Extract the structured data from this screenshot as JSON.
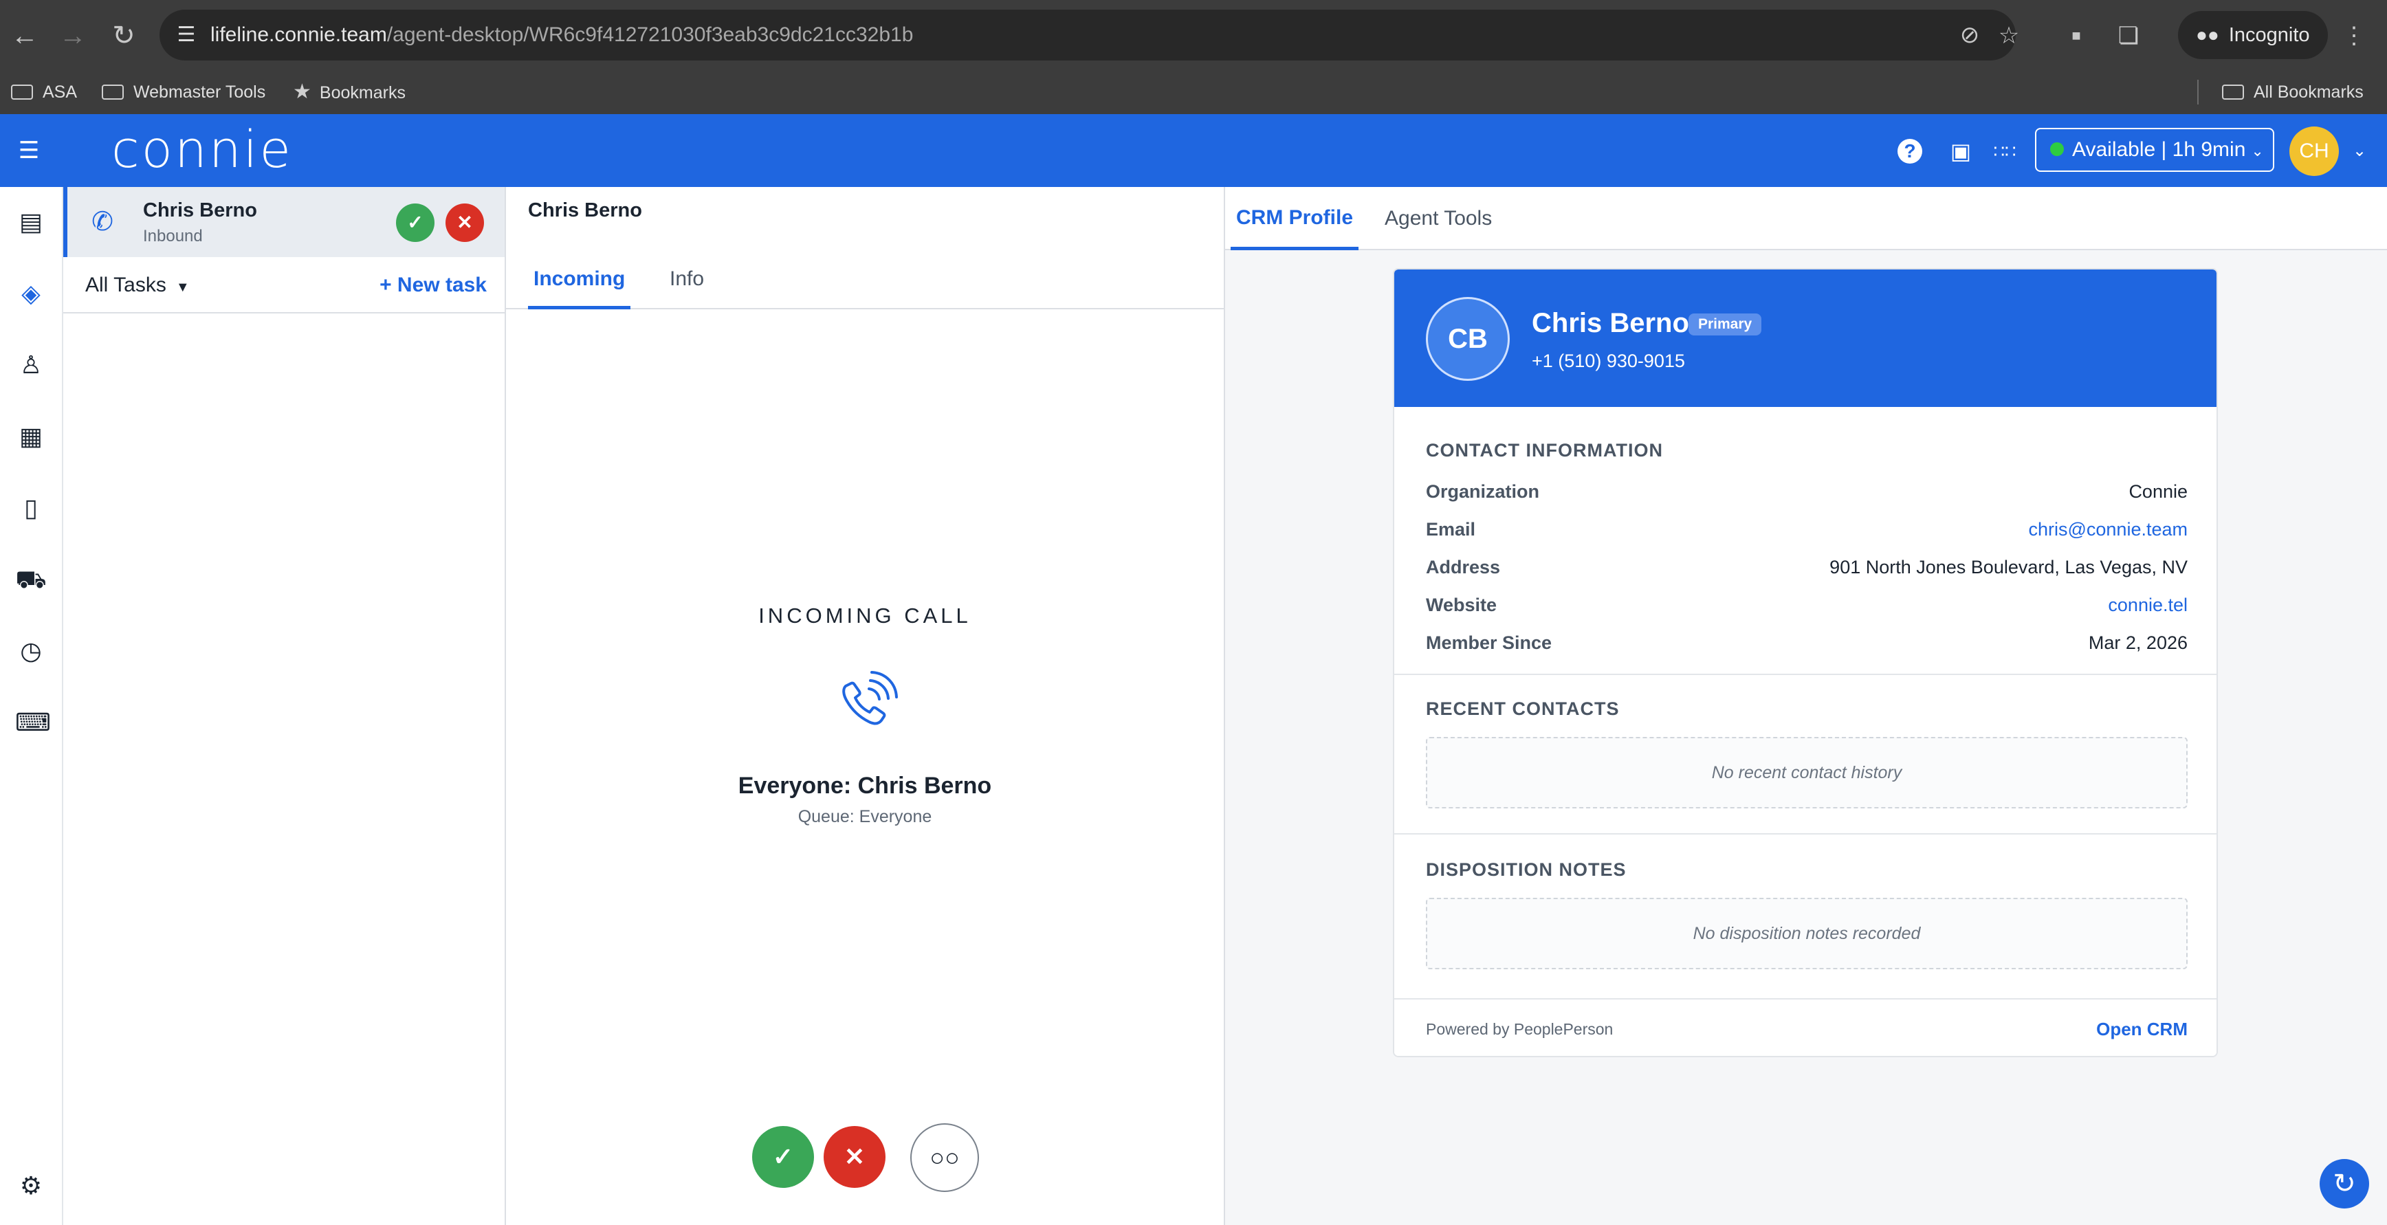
{
  "browser": {
    "url_host": "lifeline.connie.team",
    "url_path": "/agent-desktop/WR6c9f412721030f3eab3c9dc21cc32b1b",
    "incognito_label": "Incognito",
    "bookmarks": [
      {
        "label": "ASA",
        "icon": "folder-icon"
      },
      {
        "label": "Webmaster Tools",
        "icon": "folder-icon"
      },
      {
        "label": "Bookmarks",
        "icon": "star-icon"
      }
    ],
    "all_bookmarks_label": "All Bookmarks"
  },
  "header": {
    "logo_text": "connie",
    "status_label": "Available | 1h 9min",
    "status_color": "#2ecc40",
    "avatar_initials": "CH",
    "brand_color": "#1f66e0"
  },
  "task": {
    "name": "Chris Berno",
    "direction": "Inbound",
    "filter_label": "All Tasks",
    "new_task_label": "+ New task"
  },
  "call": {
    "title": "Chris Berno",
    "tabs": [
      "Incoming",
      "Info"
    ],
    "incoming_label": "INCOMING CALL",
    "caller_line": "Everyone: Chris Berno",
    "queue_line": "Queue: Everyone"
  },
  "crm": {
    "tabs": [
      "CRM Profile",
      "Agent Tools"
    ],
    "initials": "CB",
    "name": "Chris Berno",
    "badge": "Primary",
    "phone": "+1 (510) 930-9015",
    "contact_section": "CONTACT INFORMATION",
    "fields": [
      {
        "label": "Organization",
        "value": "Connie"
      },
      {
        "label": "Email",
        "value": "chris@connie.team"
      },
      {
        "label": "Address",
        "value": "901 North Jones Boulevard, Las Vegas, NV"
      },
      {
        "label": "Website",
        "value": "connie.tel"
      },
      {
        "label": "Member Since",
        "value": "Mar 2, 2026"
      }
    ],
    "recent_section": "RECENT CONTACTS",
    "recent_empty": "No recent contact history",
    "notes_section": "DISPOSITION NOTES",
    "notes_empty": "No disposition notes recorded",
    "powered_by": "Powered by PeoplePerson",
    "open_crm": "Open CRM"
  }
}
